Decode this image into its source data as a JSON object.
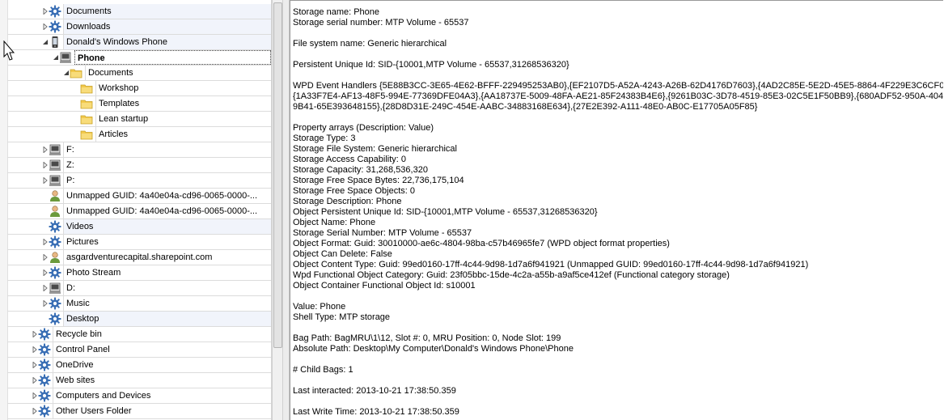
{
  "tree": {
    "items": [
      {
        "label": "Documents",
        "icon": "gear-icon",
        "level": 3,
        "expander": "collapsed",
        "bg": "tinted"
      },
      {
        "label": "Downloads",
        "icon": "gear-icon",
        "level": 3,
        "expander": "collapsed",
        "bg": "tinted"
      },
      {
        "label": "Donald's Windows Phone",
        "icon": "phone-icon",
        "level": 3,
        "expander": "expanded",
        "bg": "tinted"
      },
      {
        "label": "Phone",
        "icon": "drive-icon",
        "level": 4,
        "expander": "expanded",
        "bg": "selected"
      },
      {
        "label": "Documents",
        "icon": "folder-icon",
        "level": 5,
        "expander": "expanded",
        "bg": "plain"
      },
      {
        "label": "Workshop",
        "icon": "folder-icon",
        "level": 6,
        "expander": "none",
        "bg": "plain"
      },
      {
        "label": "Templates",
        "icon": "folder-icon",
        "level": 6,
        "expander": "none",
        "bg": "plain"
      },
      {
        "label": "Lean startup",
        "icon": "folder-icon",
        "level": 6,
        "expander": "none",
        "bg": "plain"
      },
      {
        "label": "Articles",
        "icon": "folder-icon",
        "level": 6,
        "expander": "none",
        "bg": "plain"
      },
      {
        "label": "F:",
        "icon": "drive-icon",
        "level": 3,
        "expander": "collapsed",
        "bg": "plain"
      },
      {
        "label": "Z:",
        "icon": "drive-icon",
        "level": 3,
        "expander": "collapsed",
        "bg": "plain"
      },
      {
        "label": "P:",
        "icon": "drive-icon",
        "level": 3,
        "expander": "collapsed",
        "bg": "plain"
      },
      {
        "label": "Unmapped GUID: 4a40e04a-cd96-0065-0000-...",
        "icon": "user-icon",
        "level": 3,
        "expander": "none",
        "bg": "plain"
      },
      {
        "label": "Unmapped GUID: 4a40e04a-cd96-0065-0000-...",
        "icon": "user-icon",
        "level": 3,
        "expander": "none",
        "bg": "plain"
      },
      {
        "label": "Videos",
        "icon": "gear-icon",
        "level": 3,
        "expander": "none",
        "bg": "tinted"
      },
      {
        "label": "Pictures",
        "icon": "gear-icon",
        "level": 3,
        "expander": "collapsed",
        "bg": "plain"
      },
      {
        "label": "asgardventurecapital.sharepoint.com",
        "icon": "user-icon",
        "level": 3,
        "expander": "collapsed",
        "bg": "plain"
      },
      {
        "label": "Photo Stream",
        "icon": "gear-icon",
        "level": 3,
        "expander": "collapsed",
        "bg": "plain"
      },
      {
        "label": "D:",
        "icon": "drive-icon",
        "level": 3,
        "expander": "collapsed",
        "bg": "plain"
      },
      {
        "label": "Music",
        "icon": "gear-icon",
        "level": 3,
        "expander": "collapsed",
        "bg": "plain"
      },
      {
        "label": "Desktop",
        "icon": "gear-icon",
        "level": 3,
        "expander": "none",
        "bg": "tinted"
      },
      {
        "label": "Recycle bin",
        "icon": "gear-icon",
        "level": 2,
        "expander": "collapsed",
        "bg": "plain"
      },
      {
        "label": "Control Panel",
        "icon": "gear-icon",
        "level": 2,
        "expander": "collapsed",
        "bg": "plain"
      },
      {
        "label": "OneDrive",
        "icon": "gear-icon",
        "level": 2,
        "expander": "collapsed",
        "bg": "plain"
      },
      {
        "label": "Web sites",
        "icon": "gear-icon",
        "level": 2,
        "expander": "collapsed",
        "bg": "plain"
      },
      {
        "label": "Computers and Devices",
        "icon": "gear-icon",
        "level": 2,
        "expander": "collapsed",
        "bg": "plain"
      },
      {
        "label": "Other Users Folder",
        "icon": "gear-icon",
        "level": 2,
        "expander": "collapsed",
        "bg": "plain"
      }
    ]
  },
  "details": {
    "lines": [
      "Storage name: Phone",
      "Storage serial number: MTP Volume - 65537",
      "",
      "File system name: Generic hierarchical",
      "",
      "Persistent Unique Id: SID-{10001,MTP Volume - 65537,31268536320}",
      "",
      "WPD Event Handlers {5E88B3CC-3E65-4E62-BFFF-229495253AB0},{EF2107D5-A52A-4243-A26B-62D4176D7603},{4AD2C85E-5E2D-45E5-8864-4F229E3C6CF0},",
      "{1A33F7E4-AF13-48F5-994E-77369DFE04A3},{AA18737E-5009-48FA-AE21-85F24383B4E6},{9261B03C-3D78-4519-85E3-02C5E1F50BB9},{680ADF52-950A-4041-",
      "9B41-65E393648155},{28D8D31E-249C-454E-AABC-34883168E634},{27E2E392-A111-48E0-AB0C-E17705A05F85}",
      "",
      "Property arrays (Description: Value)",
      "Storage Type: 3",
      "Storage File System: Generic hierarchical",
      "Storage Access Capability: 0",
      "Storage Capacity: 31,268,536,320",
      "Storage Free Space Bytes: 22,736,175,104",
      "Storage Free Space Objects: 0",
      "Storage Description: Phone",
      "Object Persistent Unique Id: SID-{10001,MTP Volume - 65537,31268536320}",
      "Object Name: Phone",
      "Storage Serial Number: MTP Volume - 65537",
      "Object Format: Guid: 30010000-ae6c-4804-98ba-c57b46965fe7 (WPD object format properties)",
      "Object Can Delete: False",
      "Object Content Type: Guid: 99ed0160-17ff-4c44-9d98-1d7a6f941921 (Unmapped GUID: 99ed0160-17ff-4c44-9d98-1d7a6f941921)",
      "Wpd Functional Object Category: Guid: 23f05bbc-15de-4c2a-a55b-a9af5ce412ef (Functional category storage)",
      "Object Container Functional Object Id: s10001",
      "",
      "Value: Phone",
      "Shell Type: MTP storage",
      "",
      "Bag Path: BagMRU\\1\\12, Slot #: 0, MRU Position: 0, Node Slot: 199",
      "Absolute Path: Desktop\\My Computer\\Donald's Windows Phone\\Phone",
      "",
      "# Child Bags: 1",
      "",
      "Last interacted: 2013-10-21 17:38:50.359",
      "",
      "Last Write Time: 2013-10-21 17:38:50.359"
    ]
  },
  "colors": {
    "row_tint": "#f1f4fb",
    "folder": "#f2c94c",
    "gear": "#3a6fb5",
    "user": "#6b9a3c"
  }
}
